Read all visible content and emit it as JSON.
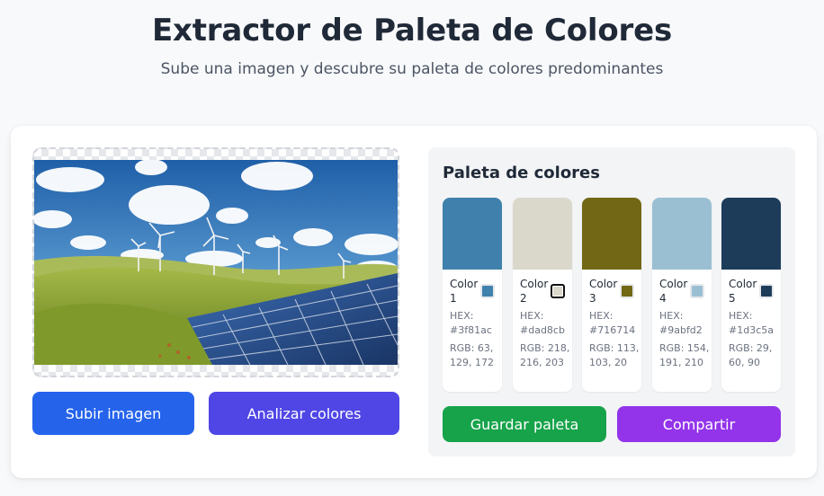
{
  "header": {
    "title": "Extractor de Paleta de Colores",
    "subtitle": "Sube una imagen y descubre su paleta de colores predominantes"
  },
  "actions": {
    "upload_label": "Subir imagen",
    "analyze_label": "Analizar colores"
  },
  "palette": {
    "title": "Paleta de colores",
    "colors": [
      {
        "name": "Color 1",
        "hex_text": "HEX: #3f81ac",
        "rgb_text": "RGB: 63, 129, 172",
        "hex": "#3f81ac",
        "selected": false
      },
      {
        "name": "Color 2",
        "hex_text": "HEX: #dad8cb",
        "rgb_text": "RGB: 218, 216, 203",
        "hex": "#dad8cb",
        "selected": true
      },
      {
        "name": "Color 3",
        "hex_text": "HEX: #716714",
        "rgb_text": "RGB: 113, 103, 20",
        "hex": "#716714",
        "selected": false
      },
      {
        "name": "Color 4",
        "hex_text": "HEX: #9abfd2",
        "rgb_text": "RGB: 154, 191, 210",
        "hex": "#9abfd2",
        "selected": false
      },
      {
        "name": "Color 5",
        "hex_text": "HEX: #1d3c5a",
        "rgb_text": "RGB: 29, 60, 90",
        "hex": "#1d3c5a",
        "selected": false
      }
    ],
    "save_label": "Guardar paleta",
    "share_label": "Compartir"
  }
}
